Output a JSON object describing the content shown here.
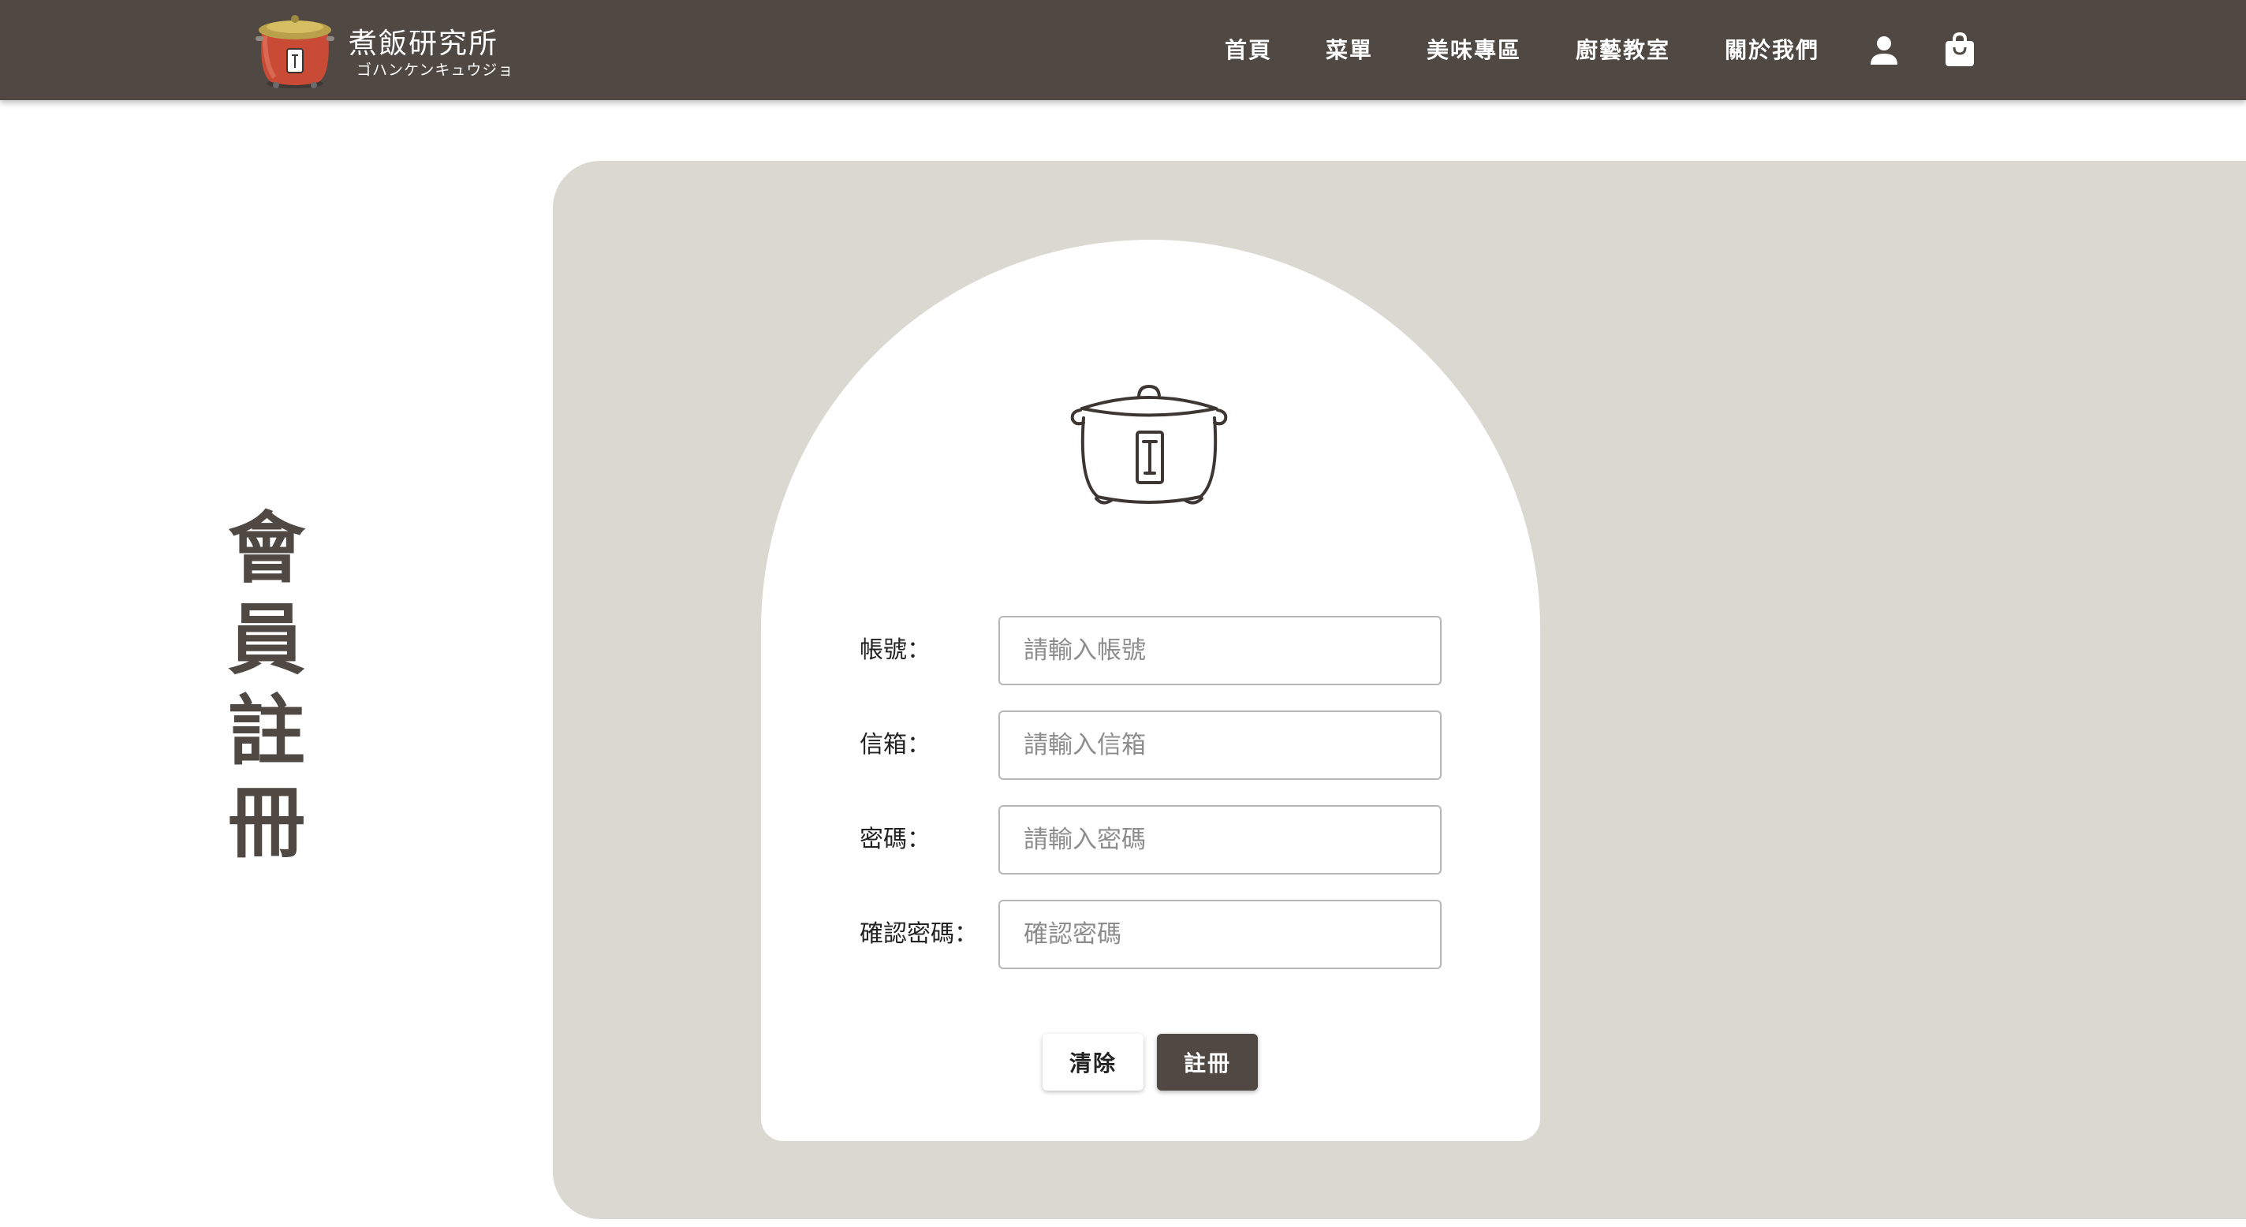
{
  "header": {
    "logo": {
      "title": "煮飯研究所",
      "subtitle": "ゴハンケンキュウジョ"
    },
    "nav": [
      {
        "label": "首頁"
      },
      {
        "label": "菜單"
      },
      {
        "label": "美味專區"
      },
      {
        "label": "廚藝教室"
      },
      {
        "label": "關於我們"
      }
    ],
    "icons": {
      "account": "user-icon",
      "cart": "shopping-bag-icon"
    }
  },
  "page": {
    "title_chars": [
      "會",
      "員",
      "註",
      "冊"
    ]
  },
  "form": {
    "illustration": "rice-cooker-icon",
    "fields": [
      {
        "label": "帳號：",
        "placeholder": "請輸入帳號",
        "value": ""
      },
      {
        "label": "信箱：",
        "placeholder": "請輸入信箱",
        "value": ""
      },
      {
        "label": "密碼：",
        "placeholder": "請輸入密碼",
        "value": ""
      },
      {
        "label": "確認密碼：",
        "placeholder": "確認密碼",
        "value": ""
      }
    ],
    "buttons": {
      "clear": "清除",
      "submit": "註冊"
    }
  },
  "colors": {
    "header_bg": "#4f4843",
    "panel_bg": "#d9d9d1",
    "primary_button": "#4f4843",
    "title_text": "#4f4843"
  }
}
